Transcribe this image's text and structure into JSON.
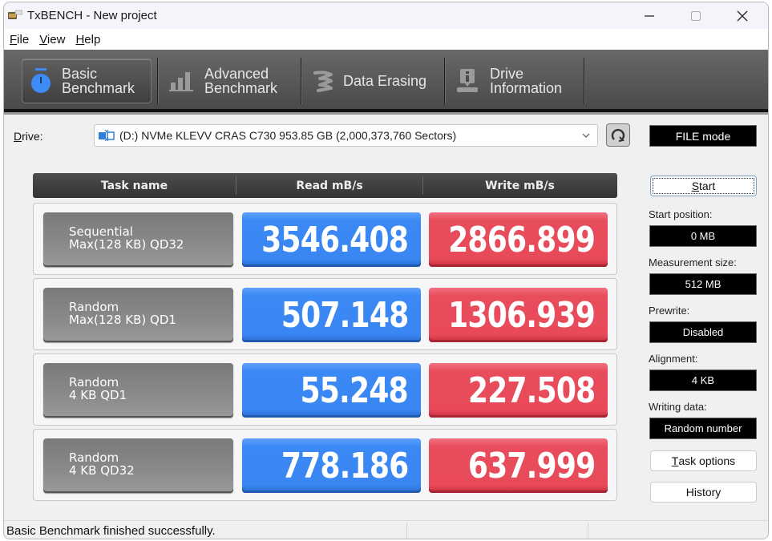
{
  "window": {
    "title": "TxBENCH - New project",
    "controls": {
      "minimize": "minimize",
      "maximize": "maximize",
      "close": "close"
    }
  },
  "menu": [
    {
      "label_first": "F",
      "label_rest": "ile"
    },
    {
      "label_first": "V",
      "label_rest": "iew"
    },
    {
      "label_first": "H",
      "label_rest": "elp"
    }
  ],
  "tabs": [
    {
      "line1": "Basic",
      "line2": "Benchmark",
      "icon": "stopwatch-icon",
      "active": true
    },
    {
      "line1": "Advanced",
      "line2": "Benchmark",
      "icon": "bar-chart-icon",
      "active": false
    },
    {
      "line1": "Data Erasing",
      "line2": "",
      "icon": "eraser-icon",
      "active": false
    },
    {
      "line1": "Drive",
      "line2": "Information",
      "icon": "drive-info-icon",
      "active": false
    }
  ],
  "drive": {
    "label_first": "D",
    "label_rest": "rive:",
    "selected": "(D:) NVMe KLEVV CRAS C730  953.85 GB (2,000,373,760 Sectors)",
    "mode": "FILE mode"
  },
  "table": {
    "headers": [
      "Task name",
      "Read mB/s",
      "Write mB/s"
    ],
    "rows": [
      {
        "task_line1": "Sequential",
        "task_line2": "Max(128 KB) QD32",
        "read": "3546.408",
        "write": "2866.899"
      },
      {
        "task_line1": "Random",
        "task_line2": "Max(128 KB) QD1",
        "read": "507.148",
        "write": "1306.939"
      },
      {
        "task_line1": "Random",
        "task_line2": "4 KB QD1",
        "read": "55.248",
        "write": "227.508"
      },
      {
        "task_line1": "Random",
        "task_line2": "4 KB QD32",
        "read": "778.186",
        "write": "637.999"
      }
    ]
  },
  "side": {
    "start_first": "S",
    "start_rest": "tart",
    "start_position_label": "Start position:",
    "start_position": "0 MB",
    "measurement_size_label": "Measurement size:",
    "measurement_size": "512 MB",
    "prewrite_label": "Prewrite:",
    "prewrite": "Disabled",
    "alignment_label": "Alignment:",
    "alignment": "4 KB",
    "writing_data_label": "Writing data:",
    "writing_data": "Random number",
    "task_options_first": "T",
    "task_options_rest": "ask options",
    "history_label": "History"
  },
  "status": {
    "message": "Basic Benchmark finished successfully."
  },
  "colors": {
    "read": "#3a86f2",
    "write": "#e84a5a",
    "task": "#8a8a8a",
    "active_tab_icon": "#3d8bf5"
  }
}
